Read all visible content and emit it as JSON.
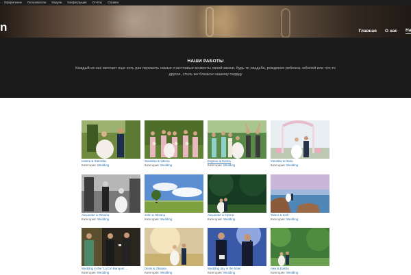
{
  "admin_bar": {
    "items": [
      "Оформление",
      "Пользователи",
      "Модули",
      "Конфигурация",
      "Отчёты",
      "Справка"
    ]
  },
  "header": {
    "logo_text": "n",
    "nav": [
      "Главная",
      "О нас",
      "Наши"
    ]
  },
  "works": {
    "title": "НАШИ РАБОТЫ",
    "description": "Каждый из нас мечтает еще хоть раз пережить самые счастливые моменты своей жизни, будь то свадьба, рождение ребенка, юбилей или что-то другое, столь же близкое нашему сердцу"
  },
  "gallery": {
    "category_prefix": "Категория:",
    "items": [
      {
        "name": "Ivanna & Stanislav",
        "category": "Wedding",
        "photo": "couple in forest"
      },
      {
        "name": "Stanislav & Valeria",
        "category": "Wedding",
        "photo": "bridesmaids group"
      },
      {
        "name": "Evgenie & Karina",
        "category": "Wedding",
        "photo": "wedding party outdoors"
      },
      {
        "name": "Yaroslav & Daria",
        "category": "Wedding",
        "photo": "wedding arch"
      },
      {
        "name": "Alexander & Oksana",
        "category": "Wedding",
        "photo": "black and white couple"
      },
      {
        "name": "John & Oksana",
        "category": "Wedding",
        "photo": "field with tree"
      },
      {
        "name": "Alexander & Alyona",
        "category": "Wedding",
        "photo": "couple in park"
      },
      {
        "name": "Tamur & Kirill",
        "category": "Wedding",
        "photo": "couple at seashore"
      },
      {
        "name": "Wedding in the \"LUCIA Banquet ...",
        "category": "Wedding",
        "photo": "banquet hosts"
      },
      {
        "name": "Denis & Oksana",
        "category": "Wedding",
        "photo": "couple in sunlight"
      },
      {
        "name": "Wedding day in the hotel",
        "category": "Wedding",
        "photo": "host with microphone"
      },
      {
        "name": "Alex & Dasha",
        "category": "Wedding",
        "photo": "couple among trees"
      }
    ]
  },
  "colors": {
    "admin_bar": "#1d1d1d",
    "works_band": "#1b1b1b",
    "link": "#2a6fa8"
  }
}
